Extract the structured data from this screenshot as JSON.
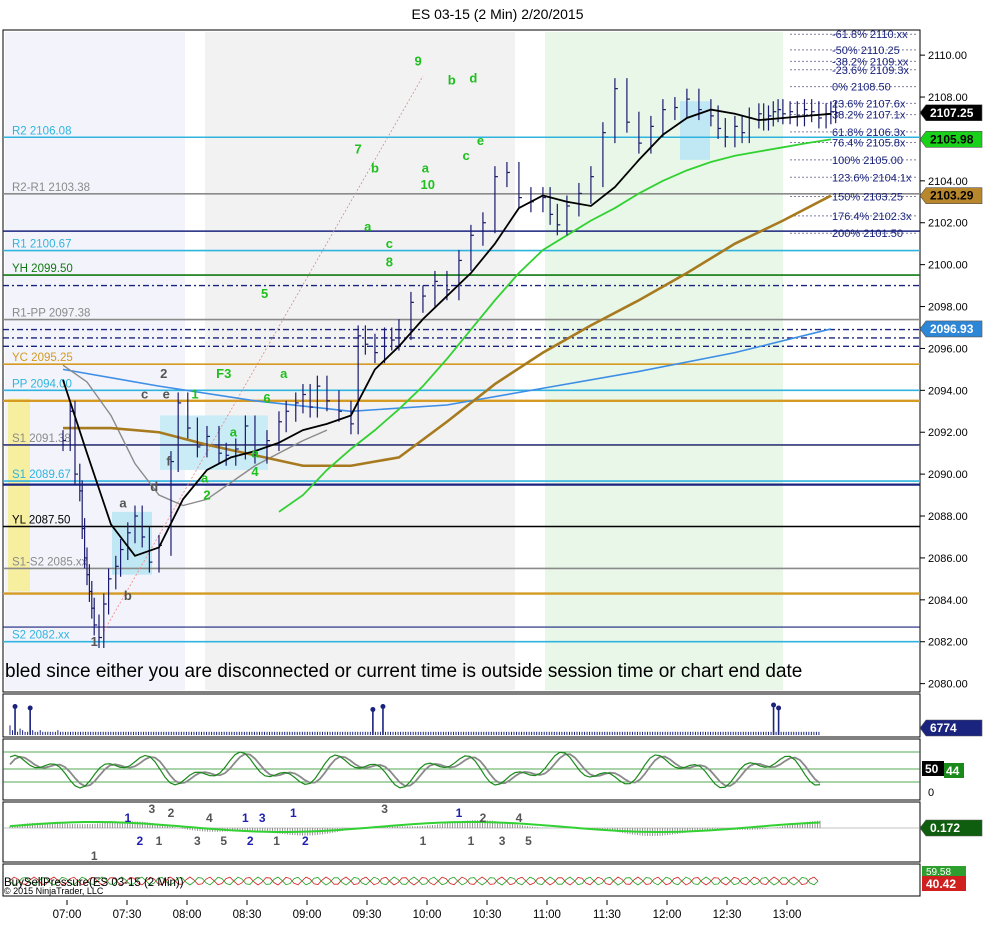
{
  "chart_data": {
    "type": "line",
    "title": "ES 03-15 (2 Min)  2/20/2015",
    "xlabel": "",
    "ylabel": "",
    "ylim": [
      2079.6,
      2111.2
    ],
    "x_ticks": [
      "07:00",
      "07:30",
      "08:00",
      "08:30",
      "09:00",
      "09:30",
      "10:00",
      "10:30",
      "11:00",
      "11:30",
      "12:00",
      "12:30",
      "13:00"
    ],
    "y_ticks": [
      "2110.00",
      "2108.00",
      "2106.00",
      "2104.00",
      "2102.00",
      "2100.00",
      "2098.00",
      "2096.00",
      "2094.00",
      "2092.00",
      "2090.00",
      "2088.00",
      "2086.00",
      "2084.00",
      "2082.00",
      "2080.00"
    ],
    "session_message": "bled since either you are disconnected or current time is outside session time or chart end date",
    "price_series": {
      "name": "ES 03-15",
      "t": [
        0,
        3,
        5,
        7,
        8,
        9,
        10,
        11,
        12,
        13,
        15,
        17,
        19,
        22,
        24,
        27,
        30,
        33,
        36,
        40,
        45,
        48,
        52,
        56,
        60,
        65,
        68,
        72,
        76,
        80,
        85,
        90,
        93,
        97,
        100,
        103,
        106,
        110,
        115,
        120,
        123,
        126,
        130,
        134,
        137,
        140,
        145,
        150,
        155,
        160,
        165,
        170,
        175,
        180,
        185,
        190,
        195,
        200,
        203,
        206,
        210,
        215,
        220,
        225,
        230,
        235,
        240,
        245,
        250,
        255,
        260,
        265,
        270,
        273,
        276,
        280,
        283,
        286,
        290,
        292,
        294,
        296,
        298,
        300,
        303,
        306,
        309,
        312,
        315,
        318,
        320,
        322
      ],
      "close": [
        2091.6,
        2093.0,
        2090.0,
        2089.2,
        2087.4,
        2086.0,
        2085.2,
        2084.4,
        2083.6,
        2082.8,
        2082.2,
        2083.8,
        2085.0,
        2085.6,
        2086.4,
        2087.2,
        2088.0,
        2087.0,
        2085.8,
        2086.6,
        2090.6,
        2093.4,
        2092.2,
        2091.3,
        2091.8,
        2091.0,
        2090.9,
        2091.2,
        2092.3,
        2091.0,
        2091.6,
        2092.5,
        2093.0,
        2093.4,
        2093.8,
        2093.2,
        2094.2,
        2093.5,
        2093.0,
        2092.4,
        2096.6,
        2096.2,
        2095.8,
        2096.5,
        2096.4,
        2096.9,
        2098.2,
        2098.5,
        2099.2,
        2098.8,
        2100.2,
        2101.4,
        2102.0,
        2104.2,
        2104.4,
        2103.2,
        2103.0,
        2103.2,
        2102.4,
        2101.9,
        2102.8,
        2103.4,
        2104.2,
        2106.3,
        2108.4,
        2106.8,
        2105.8,
        2106.6,
        2107.4,
        2107.5,
        2107.9,
        2107.4,
        2107.1,
        2106.5,
        2106.1,
        2106.6,
        2106.3,
        2107.0,
        2107.2,
        2106.9,
        2107.1,
        2107.3,
        2107.4,
        2107.2,
        2107.3,
        2107.1,
        2107.4,
        2107.3,
        2107.0,
        2107.2,
        2107.3,
        2107.25
      ]
    },
    "ema_fast": {
      "t": [
        0,
        10,
        20,
        30,
        40,
        50,
        60,
        70,
        80,
        90,
        100,
        110,
        120,
        130,
        140,
        150,
        160,
        170,
        180,
        190,
        200,
        210,
        220,
        230,
        240,
        250,
        260,
        270,
        280,
        290,
        300,
        310,
        320
      ],
      "values": [
        2094.5,
        2091.0,
        2087.6,
        2086.1,
        2086.5,
        2088.8,
        2090.2,
        2090.8,
        2091.1,
        2091.5,
        2092.1,
        2092.4,
        2092.8,
        2095.0,
        2096.1,
        2097.4,
        2098.5,
        2099.6,
        2101.0,
        2102.7,
        2103.3,
        2103.0,
        2102.8,
        2103.7,
        2105.0,
        2106.2,
        2107.0,
        2107.4,
        2107.2,
        2106.9,
        2107.0,
        2107.1,
        2107.2
      ]
    },
    "ema_green": {
      "t": [
        90,
        100,
        110,
        120,
        130,
        140,
        150,
        160,
        170,
        180,
        190,
        200,
        210,
        220,
        230,
        240,
        250,
        260,
        270,
        280,
        290,
        300,
        310,
        320
      ],
      "values": [
        2088.2,
        2089.0,
        2090.2,
        2091.2,
        2092.1,
        2093.1,
        2094.2,
        2095.5,
        2096.9,
        2098.3,
        2099.6,
        2100.7,
        2101.4,
        2102.1,
        2102.7,
        2103.4,
        2104.0,
        2104.5,
        2104.9,
        2105.2,
        2105.4,
        2105.6,
        2105.8,
        2105.98
      ]
    },
    "sma_gray": {
      "t": [
        0,
        10,
        20,
        30,
        40,
        50,
        60,
        70,
        80,
        90,
        100,
        110
      ],
      "values": [
        2095.2,
        2094.4,
        2092.8,
        2090.5,
        2089.0,
        2088.5,
        2088.8,
        2089.6,
        2090.4,
        2091.0,
        2091.6,
        2092.1
      ]
    },
    "sma_brown": {
      "t": [
        0,
        20,
        40,
        60,
        80,
        100,
        120,
        140,
        160,
        180,
        200,
        220,
        240,
        260,
        280,
        300,
        320
      ],
      "values": [
        2092.2,
        2092.2,
        2092.0,
        2091.4,
        2090.9,
        2090.4,
        2090.4,
        2090.8,
        2092.5,
        2094.3,
        2095.8,
        2097.1,
        2098.3,
        2099.6,
        2101.0,
        2102.1,
        2103.29
      ]
    },
    "ma_blue": {
      "t": [
        0,
        40,
        80,
        120,
        160,
        200,
        240,
        280,
        320
      ],
      "values": [
        2095.0,
        2094.2,
        2093.5,
        2093.0,
        2093.3,
        2094.1,
        2094.9,
        2095.8,
        2096.93
      ]
    },
    "reference_lines": [
      {
        "label": "R2 2106.08",
        "value": 2106.08,
        "color": "#2fb4df"
      },
      {
        "label": "R2-R1 2103.38",
        "value": 2103.38,
        "color": "#8a8a8a"
      },
      {
        "label": "R1 2100.67",
        "value": 2100.67,
        "color": "#2fb4df"
      },
      {
        "label": "YH 2099.50",
        "value": 2099.5,
        "color": "#117a11"
      },
      {
        "label": "R1-PP 2097.38",
        "value": 2097.38,
        "color": "#8a8a8a"
      },
      {
        "label": "YC 2095.25",
        "value": 2095.25,
        "color": "#d49a22"
      },
      {
        "label": "PP 2094.00",
        "value": 2094.0,
        "color": "#2fb4df"
      },
      {
        "label": "S1 2091.38",
        "value": 2091.38,
        "color": "#8a8a8a"
      },
      {
        "label": "S1 2089.67",
        "value": 2089.67,
        "color": "#2fb4df"
      },
      {
        "label": "YL 2087.50",
        "value": 2087.5,
        "color": "#000000"
      },
      {
        "label": "S1-S2 2085.xx",
        "value": 2085.5,
        "color": "#8a8a8a"
      },
      {
        "label": "S2 2082.xx",
        "value": 2082.0,
        "color": "#2fb4df"
      }
    ],
    "fib_levels": [
      {
        "label": "-61.8%  2110.xx",
        "value": 2111.0
      },
      {
        "label": "-50%  2110.25",
        "value": 2110.25
      },
      {
        "label": "-38.2%  2109.xx",
        "value": 2109.7
      },
      {
        "label": "-23.6%  2109.3x",
        "value": 2109.3
      },
      {
        "label": "0%  2108.50",
        "value": 2108.5
      },
      {
        "label": "23.6%  2107.6x",
        "value": 2107.7
      },
      {
        "label": "38.2%  2107.1x",
        "value": 2107.16
      },
      {
        "label": "61.8%  2106.3x",
        "value": 2106.34
      },
      {
        "label": "76.4%  2105.8x",
        "value": 2105.83
      },
      {
        "label": "100%  2105.00",
        "value": 2105.0
      },
      {
        "label": "123.6%  2104.1x",
        "value": 2104.17
      },
      {
        "label": "150%  2103.25",
        "value": 2103.25
      },
      {
        "label": "176.4%  2102.3x",
        "value": 2102.33
      },
      {
        "label": "200%  2101.50",
        "value": 2101.5
      }
    ],
    "price_badges": [
      {
        "text": "2107.25",
        "value": 2107.25,
        "bg": "#000000",
        "fg": "#ffffff"
      },
      {
        "text": "2105.98",
        "value": 2105.98,
        "bg": "#19d119",
        "fg": "#000000"
      },
      {
        "text": "2103.29",
        "value": 2103.29,
        "bg": "#b8862b",
        "fg": "#000000"
      },
      {
        "text": "2096.93",
        "value": 2096.93,
        "bg": "#2e86d6",
        "fg": "#ffffff"
      }
    ],
    "wave_labels": [
      {
        "text": "1",
        "t": 13,
        "v": 2081.8,
        "color": "#555555"
      },
      {
        "text": "a",
        "t": 25,
        "v": 2088.4,
        "color": "#555555"
      },
      {
        "text": "b",
        "t": 27,
        "v": 2084.0,
        "color": "#555555"
      },
      {
        "text": "c",
        "t": 34,
        "v": 2093.6,
        "color": "#555555"
      },
      {
        "text": "2",
        "t": 42,
        "v": 2094.6,
        "color": "#555555"
      },
      {
        "text": "e",
        "t": 43,
        "v": 2093.6,
        "color": "#555555"
      },
      {
        "text": "d",
        "t": 38,
        "v": 2089.2,
        "color": "#555555"
      },
      {
        "text": "f",
        "t": 44,
        "v": 2090.4,
        "color": "#555555"
      },
      {
        "text": "1",
        "t": 55,
        "v": 2093.6,
        "color": "#1fbf1f"
      },
      {
        "text": "a",
        "t": 59,
        "v": 2089.6,
        "color": "#1fbf1f"
      },
      {
        "text": "2",
        "t": 60,
        "v": 2088.8,
        "color": "#1fbf1f"
      },
      {
        "text": "F3",
        "t": 67,
        "v": 2094.6,
        "color": "#1fbf1f"
      },
      {
        "text": "a",
        "t": 71,
        "v": 2091.8,
        "color": "#1fbf1f"
      },
      {
        "text": "a",
        "t": 80,
        "v": 2090.8,
        "color": "#1fbf1f"
      },
      {
        "text": "4",
        "t": 80,
        "v": 2089.9,
        "color": "#1fbf1f"
      },
      {
        "text": "6",
        "t": 85,
        "v": 2093.4,
        "color": "#1fbf1f"
      },
      {
        "text": "5",
        "t": 84,
        "v": 2098.4,
        "color": "#1fbf1f"
      },
      {
        "text": "a",
        "t": 92,
        "v": 2094.6,
        "color": "#1fbf1f"
      },
      {
        "text": "7",
        "t": 123,
        "v": 2105.3,
        "color": "#1fbf1f"
      },
      {
        "text": "b",
        "t": 130,
        "v": 2104.4,
        "color": "#1fbf1f"
      },
      {
        "text": "a",
        "t": 127,
        "v": 2101.6,
        "color": "#1fbf1f"
      },
      {
        "text": "c",
        "t": 136,
        "v": 2100.8,
        "color": "#1fbf1f"
      },
      {
        "text": "8",
        "t": 136,
        "v": 2099.9,
        "color": "#1fbf1f"
      },
      {
        "text": "9",
        "t": 148,
        "v": 2109.5,
        "color": "#1fbf1f"
      },
      {
        "text": "a",
        "t": 151,
        "v": 2104.4,
        "color": "#1fbf1f"
      },
      {
        "text": "10",
        "t": 152,
        "v": 2103.6,
        "color": "#1fbf1f"
      },
      {
        "text": "b",
        "t": 162,
        "v": 2108.6,
        "color": "#1fbf1f"
      },
      {
        "text": "d",
        "t": 171,
        "v": 2108.7,
        "color": "#1fbf1f"
      },
      {
        "text": "c",
        "t": 168,
        "v": 2105.0,
        "color": "#1fbf1f"
      },
      {
        "text": "e",
        "t": 174,
        "v": 2105.7,
        "color": "#1fbf1f"
      }
    ],
    "volume": {
      "badge": "6774",
      "values": [
        6,
        3,
        5,
        2,
        4,
        3,
        2,
        2,
        2,
        3,
        2,
        2,
        3,
        2,
        2,
        2,
        2,
        2,
        2,
        3,
        2,
        2,
        2,
        2,
        2,
        2,
        2,
        2,
        2,
        2,
        2,
        2,
        2,
        2,
        2,
        2,
        2,
        2,
        2,
        2,
        2,
        2,
        2,
        2,
        2,
        2,
        2,
        2,
        2,
        2,
        2,
        2,
        2,
        2,
        2,
        2,
        2,
        2,
        2,
        2,
        2,
        2,
        2,
        2,
        2,
        2,
        2,
        2,
        2,
        2,
        2,
        2,
        2,
        2,
        2,
        2,
        2,
        2,
        2,
        2,
        2,
        2,
        2,
        2,
        2,
        2,
        2,
        2,
        2,
        2,
        2,
        2,
        2,
        2,
        2,
        2,
        2,
        2,
        2,
        2,
        2,
        2,
        2,
        2,
        2,
        2,
        2,
        2,
        2,
        2,
        2,
        2,
        2,
        2,
        2,
        2,
        2,
        2,
        2,
        2,
        2,
        2,
        2,
        2,
        2,
        2,
        2,
        2,
        2,
        2,
        2,
        2,
        2,
        2,
        2,
        2,
        2,
        2,
        2,
        2,
        2,
        2,
        2,
        2,
        2,
        2,
        2,
        2,
        2,
        2,
        2,
        2,
        2,
        2,
        2,
        2,
        2,
        2,
        2,
        2,
        2,
        2,
        2,
        2,
        2,
        2,
        2,
        2,
        2,
        2,
        2,
        2,
        2,
        2,
        2,
        2,
        2,
        2,
        2,
        2,
        2,
        2,
        2,
        2,
        2,
        2,
        2,
        2,
        2,
        2,
        2,
        2,
        2,
        2,
        2,
        2,
        2,
        2,
        2,
        2,
        2,
        2,
        2,
        2,
        2,
        2,
        2,
        2,
        2,
        2,
        2,
        2,
        2,
        2,
        2,
        2,
        2,
        2,
        2,
        2,
        2,
        2,
        2,
        2,
        2,
        2,
        2,
        2,
        2,
        2,
        2,
        2,
        2,
        2,
        2,
        2,
        2,
        2,
        2,
        2,
        2,
        2,
        2,
        2,
        2,
        2,
        2,
        2,
        2,
        2,
        2,
        2,
        2,
        2,
        2,
        2,
        2,
        2,
        2,
        2,
        2,
        2,
        2,
        2,
        2,
        2,
        2,
        2,
        2,
        2,
        2,
        2,
        2,
        2,
        2,
        2,
        2,
        2,
        2,
        2,
        2,
        2,
        2,
        2,
        2,
        2,
        2,
        2,
        2,
        2,
        2,
        2,
        2,
        2,
        2,
        2,
        2,
        2,
        2,
        2,
        2,
        2,
        2,
        2,
        2,
        2,
        2,
        2,
        2,
        2,
        2,
        2,
        2,
        2,
        2,
        2,
        2,
        2,
        2,
        2,
        2,
        2,
        2,
        2,
        2,
        2,
        2,
        2,
        2,
        2,
        2,
        2,
        2,
        2,
        2,
        2,
        2,
        2,
        2
      ],
      "spikes": [
        {
          "i": 2,
          "h": 0.95
        },
        {
          "i": 8,
          "h": 0.9
        },
        {
          "i": 144,
          "h": 0.85
        },
        {
          "i": 148,
          "h": 0.95
        },
        {
          "i": 303,
          "h": 1.0
        },
        {
          "i": 305,
          "h": 0.9
        }
      ]
    },
    "stochastic": {
      "badge_top": "50",
      "badge_value": "44",
      "zero_label": "0"
    },
    "macd": {
      "badge": "0.172",
      "labels": [
        {
          "text": "1",
          "t": 13,
          "row": "low",
          "color": "#555555"
        },
        {
          "text": "1",
          "t": 27,
          "row": "high",
          "color": "#2020b0"
        },
        {
          "text": "2",
          "t": 32,
          "row": "mid",
          "color": "#2020b0"
        },
        {
          "text": "3",
          "t": 37,
          "row": "top",
          "color": "#555555"
        },
        {
          "text": "1",
          "t": 40,
          "row": "mid",
          "color": "#555555"
        },
        {
          "text": "2",
          "t": 45,
          "row": "topb",
          "color": "#555555"
        },
        {
          "text": "3",
          "t": 56,
          "row": "mid",
          "color": "#555555"
        },
        {
          "text": "4",
          "t": 61,
          "row": "high",
          "color": "#555555"
        },
        {
          "text": "5",
          "t": 67,
          "row": "mid",
          "color": "#555555"
        },
        {
          "text": "1",
          "t": 76,
          "row": "high",
          "color": "#2020b0"
        },
        {
          "text": "2",
          "t": 78,
          "row": "mid",
          "color": "#2020b0"
        },
        {
          "text": "3",
          "t": 83,
          "row": "high",
          "color": "#2020b0"
        },
        {
          "text": "1",
          "t": 89,
          "row": "mid",
          "color": "#555555"
        },
        {
          "text": "1",
          "t": 96,
          "row": "topb",
          "color": "#2020b0"
        },
        {
          "text": "2",
          "t": 101,
          "row": "mid",
          "color": "#2020b0"
        },
        {
          "text": "3",
          "t": 134,
          "row": "top",
          "color": "#555555"
        },
        {
          "text": "1",
          "t": 150,
          "row": "mid",
          "color": "#555555"
        },
        {
          "text": "1",
          "t": 165,
          "row": "topb",
          "color": "#2020b0"
        },
        {
          "text": "1",
          "t": 170,
          "row": "mid",
          "color": "#555555"
        },
        {
          "text": "2",
          "t": 175,
          "row": "high",
          "color": "#555555"
        },
        {
          "text": "3",
          "t": 183,
          "row": "mid",
          "color": "#555555"
        },
        {
          "text": "4",
          "t": 190,
          "row": "high",
          "color": "#555555"
        },
        {
          "text": "5",
          "t": 194,
          "row": "mid",
          "color": "#555555"
        }
      ]
    },
    "buysell": {
      "legend": "BuySellPressure(ES 03-15 (2 Min))",
      "copyright": "© 2015 NinjaTrader, LLC",
      "badge_top": "59.58",
      "badge_value": "40.42"
    }
  }
}
